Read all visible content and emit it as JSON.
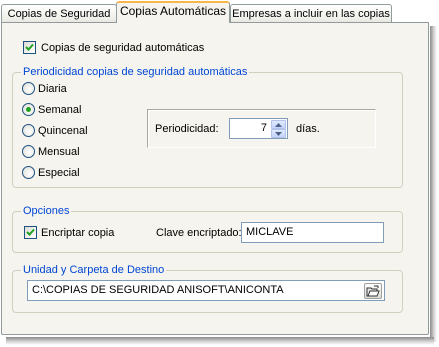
{
  "tabs": [
    {
      "label": "Copias de Seguridad",
      "selected": false
    },
    {
      "label": "Copias Automáticas",
      "selected": true
    },
    {
      "label": "Empresas a incluir en las copias",
      "selected": false
    }
  ],
  "auto_backup": {
    "label": "Copias de seguridad automáticas",
    "checked": true
  },
  "periodicidad_group": {
    "title": "Periodicidad copias  de seguridad automáticas",
    "options": [
      {
        "label": "Diaria",
        "selected": false
      },
      {
        "label": "Semanal",
        "selected": true
      },
      {
        "label": "Quincenal",
        "selected": false
      },
      {
        "label": "Mensual",
        "selected": false
      },
      {
        "label": "Especial",
        "selected": false
      }
    ],
    "periodicidad_label": "Periodicidad:",
    "periodicidad_value": "7",
    "unit_label": "días."
  },
  "opciones_group": {
    "title": "Opciones",
    "encrypt_label": "Encriptar copia",
    "encrypt_checked": true,
    "key_label": "Clave encriptado:",
    "key_value": "MICLAVE"
  },
  "destino_group": {
    "title": "Unidad y Carpeta de Destino",
    "path_value": "C:\\COPIAS DE SEGURIDAD ANISOFT\\ANICONTA",
    "browse_icon": "open-folder-icon"
  },
  "colors": {
    "group_title": "#0046d5",
    "radio_selected": "#21a121",
    "active_tab_accent": "#f7b74f"
  }
}
